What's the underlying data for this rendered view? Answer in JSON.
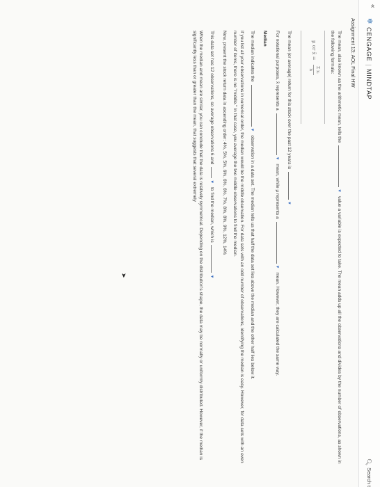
{
  "header": {
    "brand": "CENGAGE",
    "product": "MINDTAP",
    "search_label": "Search t",
    "assignment_title": "Assignment 13: AOL Final HW"
  },
  "mean_section": {
    "intro_a": "The mean, also known as the arithmetic mean, tells the",
    "intro_b": "value a variable is expected to take. The mean adds up all the",
    "intro_c": "observations and divides by the number of observations, as shown in the following formula:",
    "formula_lhs": "μ or x̄ =",
    "formula_num": "Σ xᵢ",
    "formula_den": "n",
    "mean_question": "The mean (or average) return for this stock over the past 12 years is",
    "notation_a": "For notational purposes, x̄ represents a",
    "notation_b": "mean, while μ represents a",
    "notation_c": "mean. However, they are calculated the",
    "notation_d": "same way."
  },
  "median_section": {
    "heading": "Median",
    "line1_a": "The median indicates the",
    "line1_b": "observation in a data set. The median tells us that half the data set lies above the median and the",
    "line1_c": "other half lies below it.",
    "para2": "If you list all your observations in numerical order, the median would be the middle observation. For data sets with an odd number of observations, identifying the median is easy. However, for data sets with an even number of items, there is no \"middle.\" In that case, you average the two middle observations to find the median.",
    "para3": "Now, present the stock return data in ascending order: 4%, 5%, 5%, 6%, 6%, 6%, 7%, 8%, 8%, 9%, 12%, 14%",
    "para4_a": "This data set has 12 observations, so average observations 6 and",
    "para4_b": "to find the median, which is",
    "para5": "When the median and mean are similar, you can conclude that the data is relatively symmetrical. Depending on the distribution's shape, the data may be normally or uniformly distributed. However, if the median is significantly less than or greater than the mean, that suggests that several extremely"
  },
  "dropdown_caret": "▼"
}
